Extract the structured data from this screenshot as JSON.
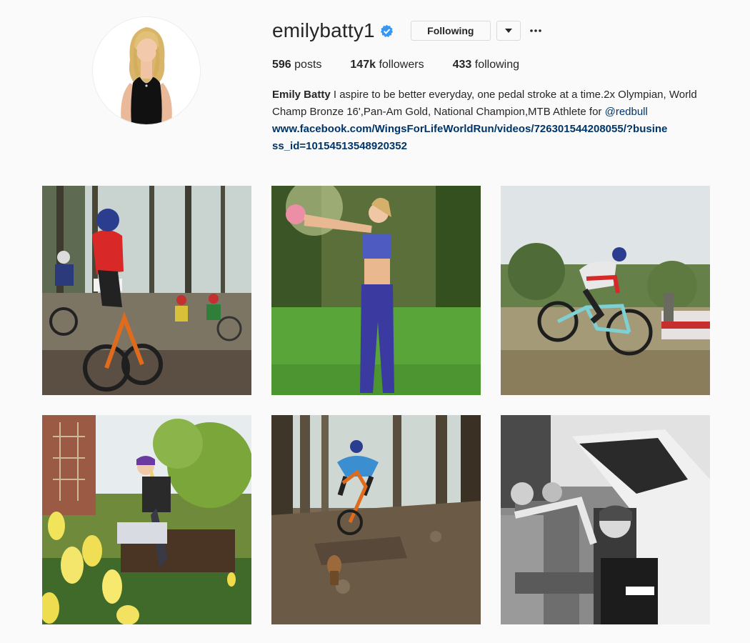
{
  "profile": {
    "username": "emilybatty1",
    "verified": true,
    "following_label": "Following",
    "dropdown_icon": "caret-down-icon",
    "more_icon": "ellipsis-icon",
    "stats": {
      "posts_count": "596",
      "posts_label": "posts",
      "followers_count": "147k",
      "followers_label": "followers",
      "following_count": "433",
      "following_label": "following"
    },
    "bio": {
      "name": "Emily Batty",
      "text": " I aspire to be better everyday, one pedal stroke at a time.2x Olympian, World Champ Bronze 16',Pan-Am Gold, National Champion,MTB Athlete for ",
      "mention": "@redbull",
      "link": "www.facebook.com/WingsForLifeWorldRun/videos/726301544208055/?business_id=10154513548920352"
    }
  },
  "colors": {
    "background": "#fafafa",
    "text": "#262626",
    "link": "#003569",
    "verified_badge": "#3897f0",
    "border": "#dbdbdb"
  },
  "posts": [
    {
      "id": "post-1"
    },
    {
      "id": "post-2"
    },
    {
      "id": "post-3"
    },
    {
      "id": "post-4"
    },
    {
      "id": "post-5"
    },
    {
      "id": "post-6"
    }
  ]
}
